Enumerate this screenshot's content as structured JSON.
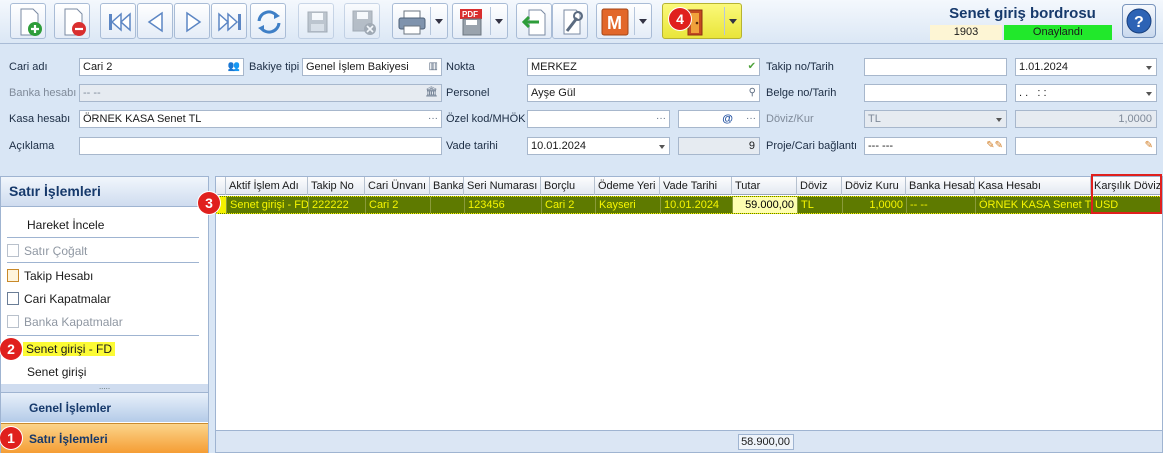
{
  "toolbar": {
    "buttons": [
      {
        "name": "new-document",
        "icon": "page-plus-icon",
        "color": "#2e9d3a"
      },
      {
        "name": "delete-document",
        "icon": "page-minus-icon",
        "color": "#d92e2e"
      },
      {
        "name": "first-record",
        "icon": "first-icon"
      },
      {
        "name": "previous-record",
        "icon": "previous-icon"
      },
      {
        "name": "next-record",
        "icon": "next-icon"
      },
      {
        "name": "last-record",
        "icon": "last-icon"
      },
      {
        "name": "refresh",
        "icon": "refresh-icon"
      },
      {
        "name": "save",
        "icon": "save-icon"
      },
      {
        "name": "cancel-save",
        "icon": "save-cancel-icon"
      },
      {
        "name": "print",
        "icon": "printer-icon"
      },
      {
        "name": "export-pdf",
        "icon": "pdf-icon",
        "label": "PDF"
      },
      {
        "name": "import",
        "icon": "import-icon"
      },
      {
        "name": "tools",
        "icon": "wrench-icon"
      },
      {
        "name": "m-module",
        "icon": "m-icon",
        "label": "M",
        "color": "#e2672a"
      },
      {
        "name": "exit",
        "icon": "exit-door-icon",
        "color": "#c34a21"
      }
    ],
    "title": "Senet giriş bordrosu",
    "doc_no": "1903",
    "status": "Onaylandı",
    "status_color": "#21e82b",
    "help_icon": "help-icon"
  },
  "form": {
    "cari_adi": {
      "label": "Cari adı",
      "value": "Cari 2"
    },
    "bakiye_tipi": {
      "label": "Bakiye tipi",
      "value": "Genel İşlem Bakiyesi"
    },
    "nokta": {
      "label": "Nokta",
      "value": "MERKEZ"
    },
    "takip_no": {
      "label": "Takip no/Tarih",
      "value": "",
      "date": "1.01.2024"
    },
    "banka_hesabi": {
      "label": "Banka hesabı",
      "value": "-- --"
    },
    "personel": {
      "label": "Personel",
      "value": "Ayşe Gül"
    },
    "belge_no": {
      "label": "Belge no/Tarih",
      "value": "",
      "date": ". .   : :"
    },
    "kasa_hesabi": {
      "label": "Kasa hesabı",
      "value": "ÖRNEK KASA Senet TL"
    },
    "ozel_kod": {
      "label": "Özel kod/MHÖK",
      "value": "",
      "extra": "@"
    },
    "doviz_kur": {
      "label": "Döviz/Kur",
      "value": "TL",
      "rate": "1,0000"
    },
    "aciklama": {
      "label": "Açıklama",
      "value": ""
    },
    "vade_tarihi": {
      "label": "Vade tarihi",
      "value": "10.01.2024",
      "count": "9"
    },
    "proje": {
      "label": "Proje/Cari bağlantı",
      "value": "--- ---",
      "value2": ""
    }
  },
  "left_panel": {
    "title": "Satır İşlemleri",
    "items": [
      {
        "label": "Hareket İncele",
        "enabled": true,
        "icon": ""
      },
      {
        "label": "Satır Çoğalt",
        "enabled": false,
        "icon": "copy-icon"
      },
      {
        "label": "Takip Hesabı",
        "enabled": true,
        "icon": "edit-icon"
      },
      {
        "label": "Cari Kapatmalar",
        "enabled": true,
        "icon": "document-icon"
      },
      {
        "label": "Banka Kapatmalar",
        "enabled": false,
        "icon": "document-icon"
      },
      {
        "label": "Senet girişi - FD",
        "enabled": true,
        "icon": "",
        "highlight": true
      },
      {
        "label": "Senet girişi",
        "enabled": true,
        "icon": ""
      }
    ],
    "groups": [
      "Genel İşlemler",
      "Satır İşlemleri"
    ]
  },
  "grid": {
    "columns": [
      "Aktif İşlem Adı",
      "Takip No",
      "Cari Ünvanı",
      "Banka",
      "Seri Numarası",
      "Borçlu",
      "Ödeme Yeri",
      "Vade Tarihi",
      "Tutar",
      "Döviz",
      "Döviz Kuru",
      "Banka Hesabı",
      "Kasa Hesabı",
      "Karşılık Dövizi"
    ],
    "rows": [
      [
        "Senet girişi - FD",
        "222222",
        "Cari 2",
        "",
        "123456",
        "Cari 2",
        "Kayseri",
        "10.01.2024",
        "59.000,00",
        "TL",
        "1,0000",
        "-- --",
        "ÖRNEK KASA Senet TL",
        "USD"
      ]
    ],
    "total": "58.900,00"
  },
  "badges": [
    "1",
    "2",
    "3",
    "4"
  ]
}
